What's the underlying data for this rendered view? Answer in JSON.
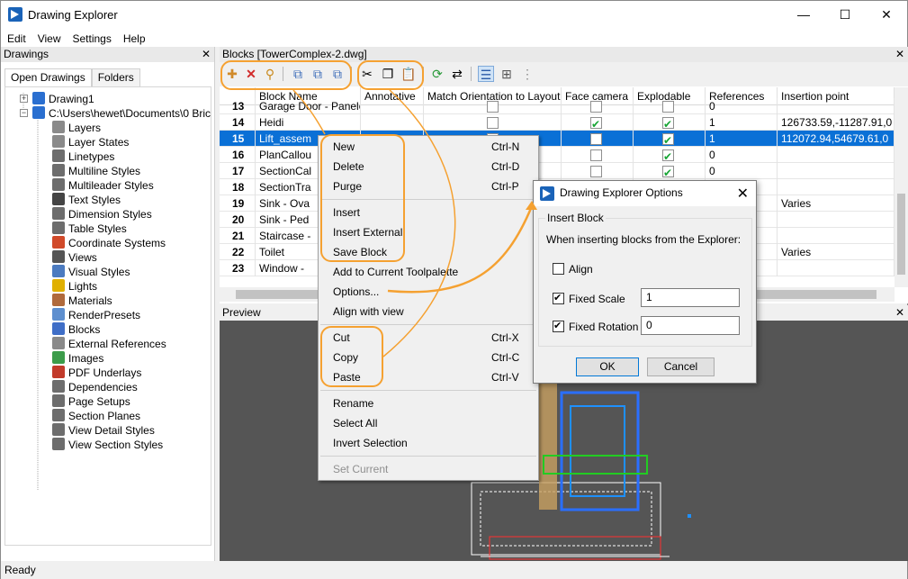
{
  "window": {
    "title": "Drawing Explorer",
    "minimize": "—",
    "maximize": "☐",
    "close": "✕"
  },
  "menu": [
    "Edit",
    "View",
    "Settings",
    "Help"
  ],
  "drawings_panel": {
    "title": "Drawings",
    "close": "✕",
    "tabs": [
      "Open Drawings",
      "Folders"
    ],
    "tree": [
      {
        "label": "Drawing1",
        "icon": "drawing-icon",
        "color": "#2a6fd0"
      },
      {
        "label": "C:\\Users\\hewet\\Documents\\0 Bric",
        "icon": "drawing-icon",
        "color": "#2a6fd0"
      },
      {
        "label": "Layers",
        "icon": "layers-icon",
        "color": "#8a8a8a"
      },
      {
        "label": "Layer States",
        "icon": "layer-states-icon",
        "color": "#8a8a8a"
      },
      {
        "label": "Linetypes",
        "icon": "linetypes-icon",
        "color": "#6d6d6d"
      },
      {
        "label": "Multiline Styles",
        "icon": "multiline-icon",
        "color": "#6d6d6d"
      },
      {
        "label": "Multileader Styles",
        "icon": "multileader-icon",
        "color": "#6d6d6d"
      },
      {
        "label": "Text Styles",
        "icon": "text-styles-icon",
        "color": "#444444"
      },
      {
        "label": "Dimension Styles",
        "icon": "dimension-icon",
        "color": "#6d6d6d"
      },
      {
        "label": "Table Styles",
        "icon": "table-icon",
        "color": "#6d6d6d"
      },
      {
        "label": "Coordinate Systems",
        "icon": "ucs-icon",
        "color": "#d14a2a"
      },
      {
        "label": "Views",
        "icon": "eye-icon",
        "color": "#555555"
      },
      {
        "label": "Visual Styles",
        "icon": "visual-styles-icon",
        "color": "#4c7bc0"
      },
      {
        "label": "Lights",
        "icon": "bulb-icon",
        "color": "#e0b000"
      },
      {
        "label": "Materials",
        "icon": "materials-icon",
        "color": "#b06a3c"
      },
      {
        "label": "RenderPresets",
        "icon": "render-icon",
        "color": "#5e8fcf"
      },
      {
        "label": "Blocks",
        "icon": "blocks-icon",
        "color": "#3f6ec7"
      },
      {
        "label": "External References",
        "icon": "xref-icon",
        "color": "#8a8a8a"
      },
      {
        "label": "Images",
        "icon": "image-icon",
        "color": "#3c9c4a"
      },
      {
        "label": "PDF Underlays",
        "icon": "pdf-icon",
        "color": "#c23b2b"
      },
      {
        "label": "Dependencies",
        "icon": "dependencies-icon",
        "color": "#6d6d6d"
      },
      {
        "label": "Page Setups",
        "icon": "page-setup-icon",
        "color": "#6d6d6d"
      },
      {
        "label": "Section Planes",
        "icon": "section-icon",
        "color": "#6d6d6d"
      },
      {
        "label": "View Detail Styles",
        "icon": "detail-icon",
        "color": "#6d6d6d"
      },
      {
        "label": "View Section Styles",
        "icon": "section-style-icon",
        "color": "#6d6d6d"
      }
    ]
  },
  "blocks_panel": {
    "title": "Blocks [TowerComplex-2.dwg]",
    "close": "✕",
    "columns": [
      "Block Name",
      "Annotative",
      "Match Orientation to Layout",
      "Face camera",
      "Explodable",
      "References",
      "Insertion point"
    ],
    "rows": [
      {
        "num": "13",
        "name": "Garage Door - Paneled",
        "face": false,
        "explode": false,
        "refs": "0",
        "ins": ""
      },
      {
        "num": "14",
        "name": "Heidi",
        "face": true,
        "explode": true,
        "refs": "1",
        "ins": "126733.59,-11287.91,0"
      },
      {
        "num": "15",
        "name": "Lift_assem",
        "face": false,
        "explode": true,
        "refs": "1",
        "ins": "112072.94,54679.61,0",
        "selected": true
      },
      {
        "num": "16",
        "name": "PlanCallou",
        "face": false,
        "explode": true,
        "refs": "0",
        "ins": ""
      },
      {
        "num": "17",
        "name": "SectionCal",
        "face": false,
        "explode": true,
        "refs": "0",
        "ins": ""
      },
      {
        "num": "18",
        "name": "SectionTra",
        "face": false,
        "explode": false,
        "refs": "",
        "ins": ""
      },
      {
        "num": "19",
        "name": "Sink - Ova",
        "face": false,
        "explode": false,
        "refs": "",
        "ins": "Varies"
      },
      {
        "num": "20",
        "name": "Sink - Ped",
        "face": false,
        "explode": false,
        "refs": "",
        "ins": ""
      },
      {
        "num": "21",
        "name": "Staircase -",
        "face": false,
        "explode": false,
        "refs": "",
        "ins": ""
      },
      {
        "num": "22",
        "name": "Toilet",
        "face": false,
        "explode": false,
        "refs": "",
        "ins": "Varies"
      },
      {
        "num": "23",
        "name": "Window -",
        "face": false,
        "explode": false,
        "refs": "",
        "ins": ""
      }
    ]
  },
  "preview_panel": {
    "title": "Preview",
    "close": "✕"
  },
  "status": "Ready",
  "context_menu": [
    {
      "label": "New",
      "shortcut": "Ctrl-N"
    },
    {
      "label": "Delete",
      "shortcut": "Ctrl-D"
    },
    {
      "label": "Purge",
      "shortcut": "Ctrl-P"
    },
    {
      "label": "Insert",
      "shortcut": ""
    },
    {
      "label": "Insert External",
      "shortcut": ""
    },
    {
      "label": "Save Block",
      "shortcut": ""
    },
    {
      "label": "Add to Current Toolpalette",
      "shortcut": ""
    },
    {
      "label": "Options...",
      "shortcut": ""
    },
    {
      "label": "Align with view",
      "shortcut": ""
    },
    {
      "label": "Cut",
      "shortcut": "Ctrl-X"
    },
    {
      "label": "Copy",
      "shortcut": "Ctrl-C"
    },
    {
      "label": "Paste",
      "shortcut": "Ctrl-V"
    },
    {
      "label": "Rename",
      "shortcut": ""
    },
    {
      "label": "Select All",
      "shortcut": ""
    },
    {
      "label": "Invert Selection",
      "shortcut": ""
    },
    {
      "label": "Set Current",
      "shortcut": "",
      "disabled": true
    }
  ],
  "dialog": {
    "title": "Drawing Explorer Options",
    "close": "✕",
    "group": "Insert Block",
    "instruction": "When inserting blocks from the Explorer:",
    "align_label": "Align",
    "align_checked": false,
    "scale_label": "Fixed Scale",
    "scale_checked": true,
    "scale_value": "1",
    "rotation_label": "Fixed Rotation",
    "rotation_checked": true,
    "rotation_value": "0",
    "ok": "OK",
    "cancel": "Cancel"
  },
  "colors": {
    "accent": "#f5a131",
    "selection": "#0a70d6",
    "check": "#18a535"
  }
}
